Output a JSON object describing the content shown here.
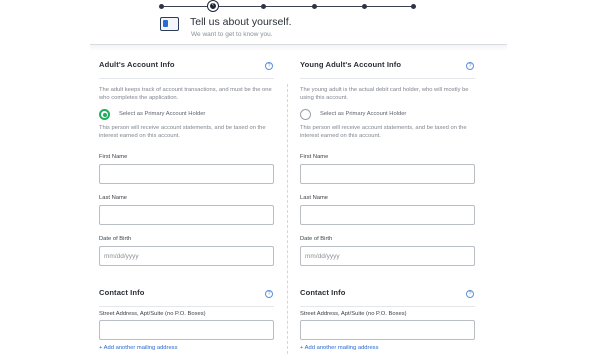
{
  "header": {
    "title": "Tell us about yourself.",
    "subtitle": "We want to get to know you."
  },
  "left": {
    "title": "Adult's Account Info",
    "help_icon": "?",
    "description": "The adult keeps track of account transactions, and must be the one who completes the application.",
    "radio_label": "Select as Primary Account Holder",
    "radio_selected": true,
    "note": "This person will receive account statements, and be taxed on the interest earned on this account.",
    "first_name_label": "First Name",
    "first_name_value": "",
    "last_name_label": "Last Name",
    "last_name_value": "",
    "dob_label": "Date of Birth",
    "dob_placeholder": "mm/dd/yyyy",
    "contact_title": "Contact Info",
    "street_label": "Street Address, Apt/Suite (no P.O. Boxes)",
    "street_value": "",
    "add_address": "+ Add another mailing address"
  },
  "right": {
    "title": "Young Adult's Account Info",
    "help_icon": "?",
    "description": "The young adult is the actual debit card holder, who will mostly be using this account.",
    "radio_label": "Select as Primary Account Holder",
    "radio_selected": false,
    "note": "This person will receive account statements, and be taxed on the interest earned on this account.",
    "first_name_label": "First Name",
    "first_name_value": "",
    "last_name_label": "Last Name",
    "last_name_value": "",
    "dob_label": "Date of Birth",
    "dob_placeholder": "mm/dd/yyyy",
    "contact_title": "Contact Info",
    "street_label": "Street Address, Apt/Suite (no P.O. Boxes)",
    "street_value": "",
    "add_address": "+ Add another mailing address"
  },
  "stepper": {
    "steps": 6,
    "current_step": 2,
    "active_glyph": "‹"
  },
  "colors": {
    "accent_green": "#1fae5b",
    "link_blue": "#2a6ad1",
    "stepper_dark": "#1f2735"
  }
}
